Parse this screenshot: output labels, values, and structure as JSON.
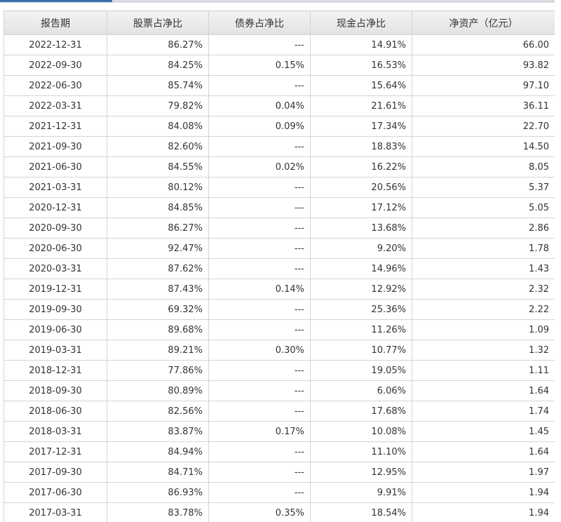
{
  "table": {
    "headers": [
      "报告期",
      "股票占净比",
      "债券占净比",
      "现金占净比",
      "净资产（亿元）"
    ],
    "rows": [
      [
        "2022-12-31",
        "86.27%",
        "---",
        "14.91%",
        "66.00"
      ],
      [
        "2022-09-30",
        "84.25%",
        "0.15%",
        "16.53%",
        "93.82"
      ],
      [
        "2022-06-30",
        "85.74%",
        "---",
        "15.64%",
        "97.10"
      ],
      [
        "2022-03-31",
        "79.82%",
        "0.04%",
        "21.61%",
        "36.11"
      ],
      [
        "2021-12-31",
        "84.08%",
        "0.09%",
        "17.34%",
        "22.70"
      ],
      [
        "2021-09-30",
        "82.60%",
        "---",
        "18.83%",
        "14.50"
      ],
      [
        "2021-06-30",
        "84.55%",
        "0.02%",
        "16.22%",
        "8.05"
      ],
      [
        "2021-03-31",
        "80.12%",
        "---",
        "20.56%",
        "5.37"
      ],
      [
        "2020-12-31",
        "84.85%",
        "---",
        "17.12%",
        "5.05"
      ],
      [
        "2020-09-30",
        "86.27%",
        "---",
        "13.68%",
        "2.86"
      ],
      [
        "2020-06-30",
        "92.47%",
        "---",
        "9.20%",
        "1.78"
      ],
      [
        "2020-03-31",
        "87.62%",
        "---",
        "14.96%",
        "1.43"
      ],
      [
        "2019-12-31",
        "87.43%",
        "0.14%",
        "12.92%",
        "2.32"
      ],
      [
        "2019-09-30",
        "69.32%",
        "---",
        "25.36%",
        "2.22"
      ],
      [
        "2019-06-30",
        "89.68%",
        "---",
        "11.26%",
        "1.09"
      ],
      [
        "2019-03-31",
        "89.21%",
        "0.30%",
        "10.77%",
        "1.32"
      ],
      [
        "2018-12-31",
        "77.86%",
        "---",
        "19.05%",
        "1.11"
      ],
      [
        "2018-09-30",
        "80.89%",
        "---",
        "6.06%",
        "1.64"
      ],
      [
        "2018-06-30",
        "82.56%",
        "---",
        "17.68%",
        "1.74"
      ],
      [
        "2018-03-31",
        "83.87%",
        "0.17%",
        "10.08%",
        "1.45"
      ],
      [
        "2017-12-31",
        "84.94%",
        "---",
        "11.10%",
        "1.64"
      ],
      [
        "2017-09-30",
        "84.71%",
        "---",
        "12.95%",
        "1.97"
      ],
      [
        "2017-06-30",
        "86.93%",
        "---",
        "9.91%",
        "1.94"
      ],
      [
        "2017-03-31",
        "83.78%",
        "0.35%",
        "18.54%",
        "1.94"
      ]
    ]
  },
  "colors": {
    "accent": "#3d6fa8",
    "header_bg": "#e8e8e8",
    "border": "#d4d4d4",
    "text": "#333333"
  }
}
